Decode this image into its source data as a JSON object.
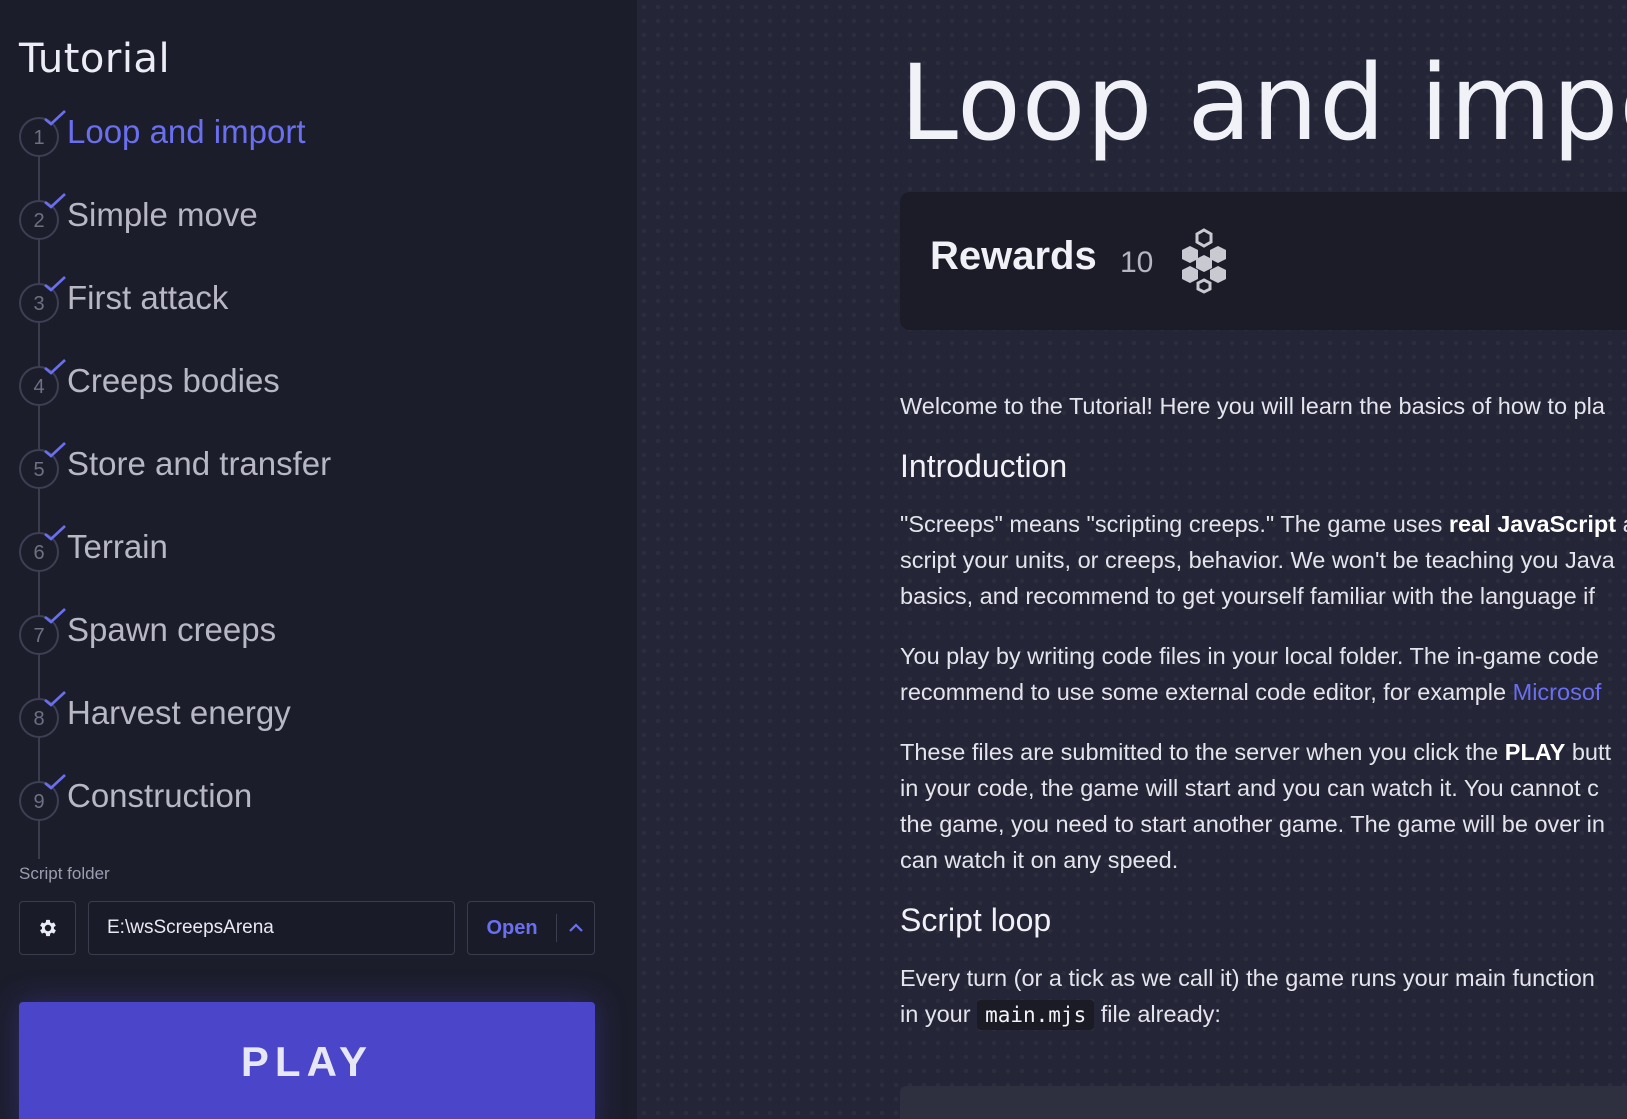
{
  "sidebar": {
    "title": "Tutorial",
    "steps": [
      {
        "num": "1",
        "label": "Loop and import",
        "active": true
      },
      {
        "num": "2",
        "label": "Simple move"
      },
      {
        "num": "3",
        "label": "First attack"
      },
      {
        "num": "4",
        "label": "Creeps bodies"
      },
      {
        "num": "5",
        "label": "Store and transfer"
      },
      {
        "num": "6",
        "label": "Terrain"
      },
      {
        "num": "7",
        "label": "Spawn creeps"
      },
      {
        "num": "8",
        "label": "Harvest energy"
      },
      {
        "num": "9",
        "label": "Construction"
      }
    ],
    "script_folder_label": "Script folder",
    "script_folder_value": "E:\\wsScreepsArena",
    "open_label": "Open",
    "play_label": "PLAY"
  },
  "main": {
    "title": "Loop and import",
    "rewards_label": "Rewards",
    "rewards_count": "10",
    "intro_text": "Welcome to the Tutorial! Here you will learn the basics of how to pla",
    "introduction_heading": "Introduction",
    "p1": {
      "line1_pre": "\"Screeps\" means \"scripting creeps.\" The game uses ",
      "line1_bold": "real JavaScript",
      "line1_post": " a",
      "line2": "script your units, or creeps, behavior. We won't be teaching you Java",
      "line3": "basics, and recommend to get yourself familiar with the language if"
    },
    "p2": {
      "line1": "You play by writing code files in your local folder. The in-game code",
      "line2_pre": "recommend to use some external code editor, for example ",
      "line2_link": "Microsof"
    },
    "p3": {
      "line1_pre": "These files are submitted to the server when you click the ",
      "line1_bold": "PLAY",
      "line1_post": " butt",
      "line2": "in your code, the game will start and you can watch it. You cannot c",
      "line3": "the game, you need to start another game. The game will be over in",
      "line4": "can watch it on any speed."
    },
    "script_loop_heading": "Script loop",
    "p4": {
      "line1": "Every turn (or a tick as we call it) the game runs your main function",
      "line2_pre": "in your ",
      "line2_code": "main.mjs",
      "line2_post": " file already:"
    }
  },
  "colors": {
    "accent": "#6a6ff0",
    "play_button": "#4a45c9",
    "sidebar_bg": "#1c1d2b",
    "main_bg": "#242536"
  },
  "icons": [
    "check-icon",
    "gear-icon",
    "chevron-up-icon",
    "rewards-hex-icon"
  ]
}
